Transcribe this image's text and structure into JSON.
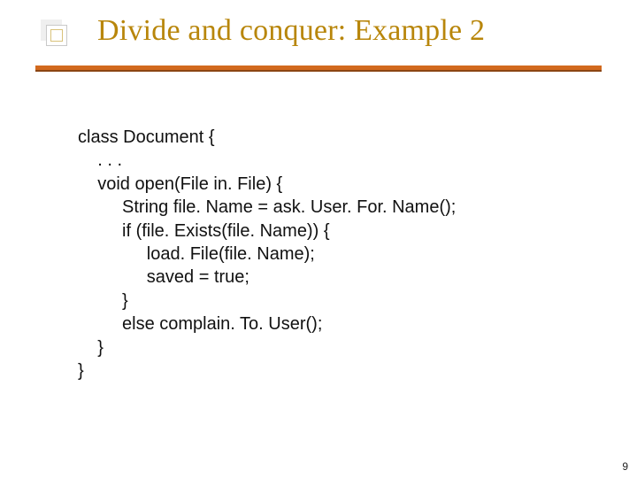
{
  "slide": {
    "title": "Divide and conquer: Example 2",
    "page_number": "9"
  },
  "code": {
    "l1": "class Document {",
    "l2": "    . . .",
    "l3": "    void open(File in. File) {",
    "l4": "         String file. Name = ask. User. For. Name();",
    "l5": "         if (file. Exists(file. Name)) {",
    "l6": "              load. File(file. Name);",
    "l7": "              saved = true;",
    "l8": "         }",
    "l9": "         else complain. To. User();",
    "l10": "    }",
    "l11": "}"
  },
  "colors": {
    "title": "#b8860b",
    "underline": "#d2691e",
    "text": "#111111"
  }
}
